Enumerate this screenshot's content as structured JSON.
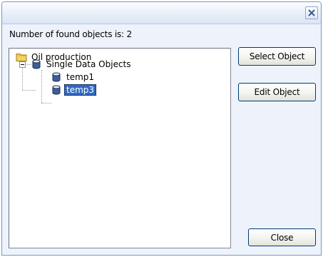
{
  "dialog": {
    "found_label": "Number of found objects is:  2"
  },
  "tree": {
    "items": [
      {
        "label": "Oil production",
        "icon": "folder-icon"
      },
      {
        "label": "Single Data Objects",
        "icon": "database-icon"
      },
      {
        "label": "temp1",
        "icon": "database-icon"
      },
      {
        "label": "temp3",
        "icon": "database-icon",
        "selected": true
      }
    ],
    "colors": {
      "selection": "#316ac5",
      "folder": "#f3d35e"
    }
  },
  "buttons": {
    "select_object": "Select Object",
    "edit_object": "Edit Object",
    "close": "Close"
  }
}
